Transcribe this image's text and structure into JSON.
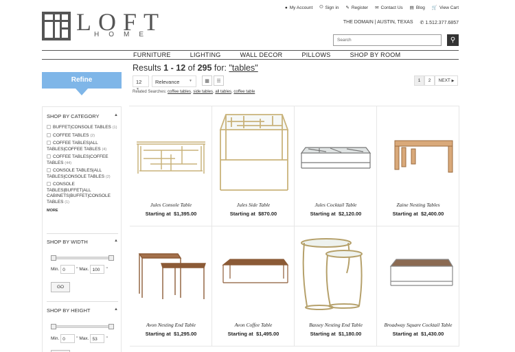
{
  "utility": {
    "account": "My Account",
    "signin": "Sign in",
    "register": "Register",
    "contact": "Contact Us",
    "blog": "Blog",
    "cart": "View Cart"
  },
  "brand": {
    "word": "LOFT",
    "sub": "HOME"
  },
  "contact_line": {
    "location": "THE DOMAIN | AUSTIN, TEXAS",
    "phone": "1.512.377.6857"
  },
  "search": {
    "placeholder": "Search"
  },
  "nav": [
    "FURNITURE",
    "LIGHTING",
    "WALL DECOR",
    "PILLOWS",
    "SHOP BY ROOM"
  ],
  "refine": {
    "label": "Refine"
  },
  "sidebar": {
    "category_title": "SHOP BY CATEGORY",
    "categories": [
      {
        "label": "BUFFET|CONSOLE TABLES",
        "count": "(1)"
      },
      {
        "label": "COFFEE TABLES",
        "count": "(2)"
      },
      {
        "label": "COFFEE TABLES|ALL TABLES|COFFEE TABLES",
        "count": "(4)"
      },
      {
        "label": "COFFEE TABLES|COFFEE TABLES",
        "count": "(44)"
      },
      {
        "label": "CONSOLE TABLES|ALL TABLES|CONSOLE TABLES",
        "count": "(2)"
      },
      {
        "label": "CONSOLE TABLES|BUFFET|ALL CABINETS|BUFFET|CONSOLE TABLES",
        "count": "(1)"
      }
    ],
    "more": "MORE",
    "width_title": "SHOP BY WIDTH",
    "width": {
      "min_label": "Min.",
      "min": "0",
      "max_label": "\" Max.",
      "max": "100",
      "unit": "\""
    },
    "go": "GO",
    "height_title": "SHOP BY HEIGHT",
    "height": {
      "min_label": "Min.",
      "min": "0",
      "max_label": "\" Max.",
      "max": "53",
      "unit": "\""
    }
  },
  "results": {
    "prefix": "Results",
    "from": "1",
    "dash": "-",
    "to": "12",
    "of": "of",
    "total": "295",
    "for": "for:",
    "term": "\"tables\""
  },
  "controls": {
    "per_page": "12",
    "sort": "Relevance"
  },
  "related": {
    "label": "Related Searches:",
    "links": [
      "coffee tables",
      "side tables",
      "all tables",
      "coffee table"
    ]
  },
  "pager": {
    "p1": "1",
    "p2": "2",
    "next": "NEXT"
  },
  "products": [
    {
      "name": "Jules Console Table",
      "price_label": "Starting at",
      "price": "$1,395.00"
    },
    {
      "name": "Jules Side Table",
      "price_label": "Starting at",
      "price": "$870.00"
    },
    {
      "name": "Jules Cocktail Table",
      "price_label": "Starting at",
      "price": "$2,120.00"
    },
    {
      "name": "Zaine Nesting Tables",
      "price_label": "Starting at",
      "price": "$2,400.00"
    },
    {
      "name": "Avon Nesting End Table",
      "price_label": "Starting at",
      "price": "$1,295.00"
    },
    {
      "name": "Avon Coffee Table",
      "price_label": "Starting at",
      "price": "$1,495.00"
    },
    {
      "name": "Bassey Nesting End Table",
      "price_label": "Starting at",
      "price": "$1,180.00"
    },
    {
      "name": "Broadway Square Cocktail Table",
      "price_label": "Starting at",
      "price": "$1,430.00"
    }
  ],
  "colors": {
    "accent": "#7fb6e8",
    "text": "#333333",
    "gold": "#c9b27a",
    "wood": "#8b5a36"
  }
}
